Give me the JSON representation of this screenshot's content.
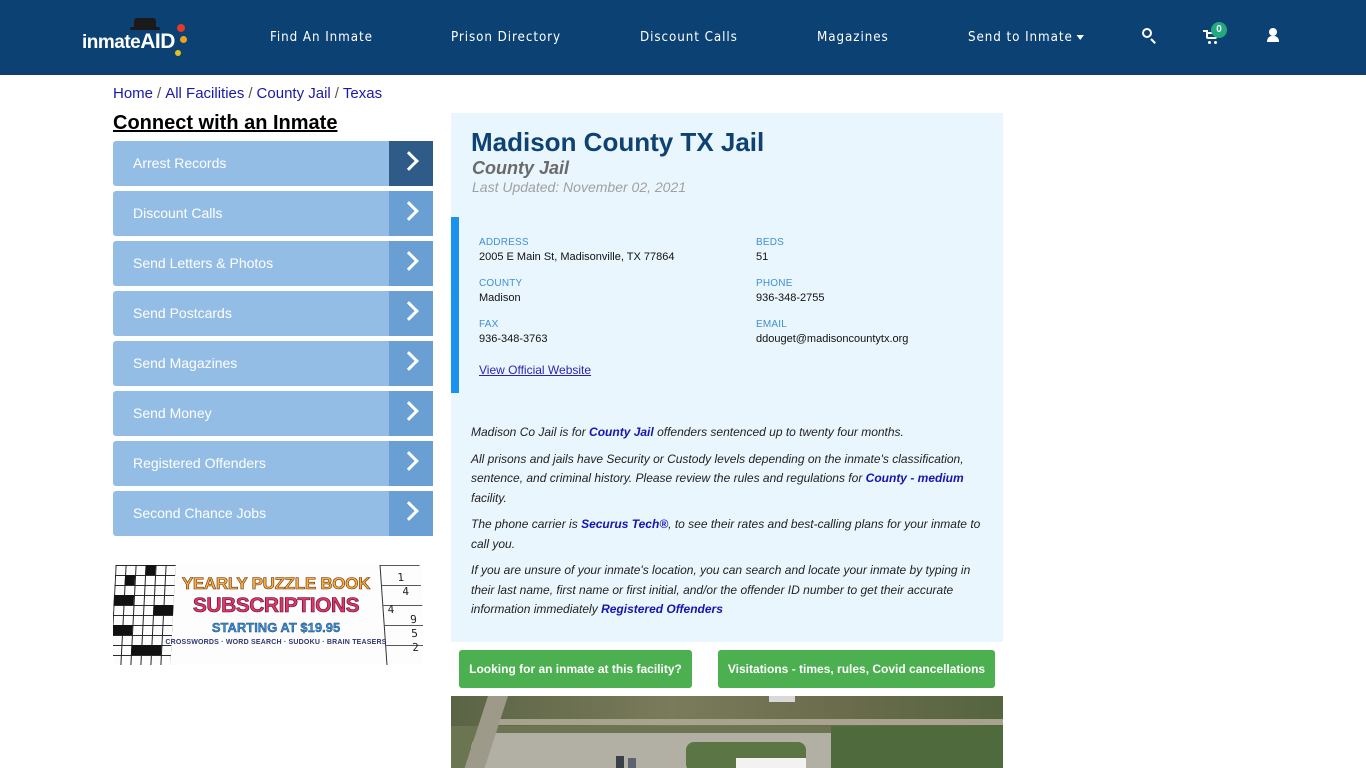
{
  "navbar": {
    "logo": {
      "text_main": "inmate",
      "text_accent": "AID"
    },
    "items": [
      {
        "label": "Find An Inmate"
      },
      {
        "label": "Prison Directory"
      },
      {
        "label": "Discount Calls"
      },
      {
        "label": "Magazines"
      },
      {
        "label": "Send to Inmate",
        "has_dropdown": true
      }
    ],
    "icons": {
      "search": "search-icon",
      "cart": "cart-icon",
      "user": "user-icon"
    },
    "cart_count": "0"
  },
  "breadcrumb": [
    {
      "label": "Home"
    },
    {
      "label": "All Facilities"
    },
    {
      "label": "County Jail"
    },
    {
      "label": "Texas"
    }
  ],
  "breadcrumb_separator": "/",
  "sidebar": {
    "title": "Connect with an Inmate",
    "items": [
      {
        "label": "Arrest Records",
        "active": true
      },
      {
        "label": "Discount Calls"
      },
      {
        "label": "Send Letters & Photos"
      },
      {
        "label": "Send Postcards"
      },
      {
        "label": "Send Magazines"
      },
      {
        "label": "Send Money"
      },
      {
        "label": "Registered Offenders"
      },
      {
        "label": "Second Chance Jobs"
      }
    ],
    "ad": {
      "line1": "YEARLY PUZZLE BOOK",
      "line2": "SUBSCRIPTIONS",
      "line3": "STARTING AT $19.95",
      "line4": "CROSSWORDS · WORD SEARCH · SUDOKU · BRAIN TEASERS",
      "sudoku_digits": [
        "1",
        "4",
        "4",
        "9",
        "5",
        "2"
      ]
    }
  },
  "facility": {
    "name": "Madison County TX Jail",
    "type": "County Jail",
    "last_updated": "Last Updated: November 02, 2021",
    "info": {
      "address_label": "ADDRESS",
      "address": "2005 E Main St, Madisonville, TX 77864",
      "beds_label": "BEDS",
      "beds": "51",
      "county_label": "COUNTY",
      "county": "Madison",
      "phone_label": "PHONE",
      "phone": "936-348-2755",
      "fax_label": "FAX",
      "fax": "936-348-3763",
      "email_label": "EMAIL",
      "email": "ddouget@madisoncountytx.org",
      "website_link": "View Official Website"
    },
    "description": {
      "p1_pre": "Madison Co Jail is for ",
      "p1_link": "County Jail",
      "p1_post": " offenders sentenced up to twenty four months.",
      "p2_pre": "All prisons and jails have Security or Custody levels depending on the inmate's classification, sentence, and criminal history. Please review the rules and regulations for ",
      "p2_link": "County - medium",
      "p2_post": " facility.",
      "p3_pre": "The phone carrier is ",
      "p3_link": "Securus Tech®",
      "p3_post": ", to see their rates and best-calling plans for your inmate to call you.",
      "p4_pre": "If you are unsure of your inmate's location, you can search and locate your inmate by typing in their last name, first name or first initial, and/or the offender ID number to get their accurate information immediately ",
      "p4_link": "Registered Offenders"
    }
  },
  "buttons": {
    "find_inmate": "Looking for an inmate at this facility?",
    "visitations": "Visitations - times, rules, Covid cancellations"
  },
  "colors": {
    "navbar_bg": "#0b4173",
    "card_bg": "#eaf6fd",
    "accent_bar": "#1b92ee",
    "sidebar_item": "#94bde6",
    "sidebar_arrow": "#6a9fd4",
    "sidebar_arrow_active": "#2f5b89",
    "button_green": "#4caf50",
    "title_blue": "#0e4272"
  }
}
